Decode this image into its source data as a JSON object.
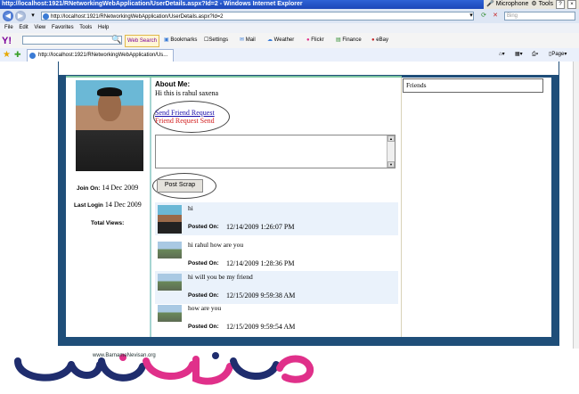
{
  "window": {
    "title": "http://localhost:1921/RNetworkingWebApplication/UserDetails.aspx?Id=2 - Windows Internet Explorer",
    "tray": {
      "microphone": "Microphone",
      "tools": "Tools",
      "help": "?"
    }
  },
  "address_bar": {
    "url": "http://localhost:1921/RNetworkingWebApplication/UserDetails.aspx?Id=2",
    "search_placeholder": "Bing"
  },
  "menu": [
    "File",
    "Edit",
    "View",
    "Favorites",
    "Tools",
    "Help"
  ],
  "yahoo_toolbar": {
    "logo": "Y!",
    "web_search": "Web Search",
    "items": [
      "Bookmarks",
      "Settings",
      "Mail",
      "Weather",
      "Flickr",
      "Finance",
      "eBay"
    ]
  },
  "tab": {
    "title": "http://localhost:1921/RNetworkingWebApplication/Us..."
  },
  "command_bar": {
    "page": "Page"
  },
  "profile": {
    "join_label": "Join On:",
    "join_date": "14 Dec 2009",
    "last_login_label": "Last Login",
    "last_login_date": "14 Dec 2009",
    "total_views_label": "Total Views:"
  },
  "about": {
    "title": "About Me:",
    "text": "Hi this is rahul saxena"
  },
  "friend_request": {
    "link": "Send Friend Request",
    "status": "Friend Request Send"
  },
  "scrap_form": {
    "post_button": "Post Scrap"
  },
  "scraps": [
    {
      "message": "hi",
      "posted_label": "Posted On:",
      "date": "12/14/2009 1:26:07 PM"
    },
    {
      "message": "hi rahul how are you",
      "posted_label": "Posted On:",
      "date": "12/14/2009 1:28:36 PM"
    },
    {
      "message": "hi will you be my friend",
      "posted_label": "Posted On:",
      "date": "12/15/2009 9:59:38 AM"
    },
    {
      "message": "how are you",
      "posted_label": "Posted On:",
      "date": "12/15/2009 9:59:54 AM"
    }
  ],
  "friends": {
    "title": "Friends"
  },
  "watermark": {
    "site": "www.BarnameNevisan.org"
  },
  "colors": {
    "frame": "#1f4e79",
    "link": "#1a0dab",
    "status": "#d21c1c",
    "scrap_alt_bg": "#eaf2fb"
  }
}
